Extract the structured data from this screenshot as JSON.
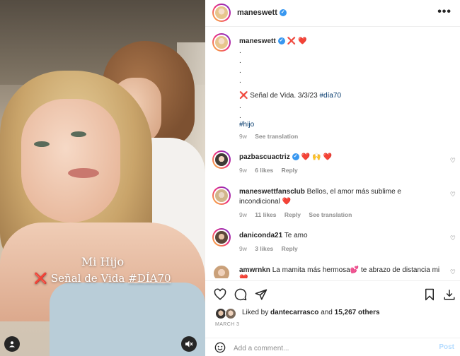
{
  "media": {
    "caption_line1": "Mi Hijo",
    "caption_line2_prefix": "❌",
    "caption_line2_text": "Señal de Vida",
    "caption_line2_tag": "#DÍA70",
    "user_icon": "user-icon",
    "mute_icon": "speaker-muted-icon"
  },
  "header": {
    "username": "maneswett",
    "verified_icon": "verified-icon",
    "more_icon": "more-options-icon",
    "more_label": "•••"
  },
  "caption": {
    "username": "maneswett",
    "after_name": "❌ ❤️",
    "dots": [
      ".",
      ".",
      ".",
      "."
    ],
    "line_x": "❌",
    "line_text": "Señal de Vida. 3/3/23",
    "line_tag": "#día70",
    "dots2": [
      ".",
      "."
    ],
    "tag2": "#hijo",
    "time": "9w",
    "see_translation": "See translation"
  },
  "comments": [
    {
      "username": "pazbascuactriz",
      "verified": true,
      "text": "❤️ 🙌 ❤️",
      "time": "9w",
      "likes": "6 likes",
      "reply": "Reply",
      "translate": ""
    },
    {
      "username": "maneswettfansclub",
      "verified": false,
      "text": "Bellos, el amor más sublime e",
      "text2": "incondicional ❤️",
      "time": "9w",
      "likes": "11 likes",
      "reply": "Reply",
      "translate": "See translation"
    },
    {
      "username": "daniconda21",
      "verified": false,
      "text": "Te amo",
      "time": "9w",
      "likes": "3 likes",
      "reply": "Reply",
      "translate": ""
    },
    {
      "username": "amwrnkn",
      "verified": false,
      "text": "La mamita más hermosa💕 te abrazo de distancia mi",
      "text2": "❤️",
      "time": "",
      "likes": "",
      "reply": "",
      "translate": ""
    }
  ],
  "liked": {
    "prefix": "Liked by",
    "user": "dantecarrasco",
    "middle": "and",
    "count": "15,267 others"
  },
  "date": "MARCH 3",
  "add_comment": {
    "placeholder": "Add a comment...",
    "post_label": "Post",
    "emoji_icon": "emoji-icon"
  },
  "colors": {
    "verified": "#3897f0",
    "heart": "#ed4956",
    "link": "#00376b",
    "muted": "#8e8e8e",
    "post_disabled": "#b3dbff"
  }
}
